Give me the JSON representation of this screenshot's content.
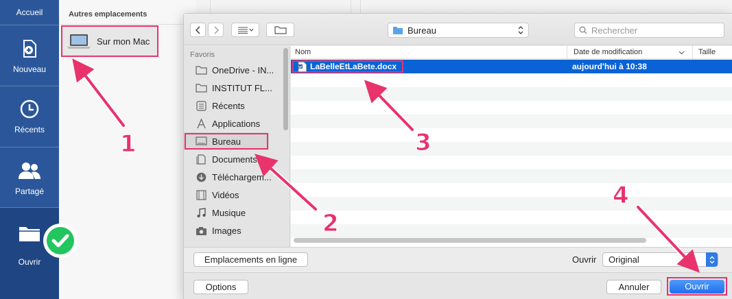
{
  "word_sidebar": {
    "home_label": "Accueil",
    "items": [
      {
        "label": "Nouveau",
        "icon": "new-document-icon"
      },
      {
        "label": "Récents",
        "icon": "clock-icon"
      },
      {
        "label": "Partagé",
        "icon": "people-icon"
      },
      {
        "label": "Ouvrir",
        "icon": "folder-icon"
      }
    ]
  },
  "backstage": {
    "section_header": "Autres emplacements",
    "location_item": "Sur mon Mac"
  },
  "dialog": {
    "location": "Bureau",
    "search_placeholder": "Rechercher",
    "sidebar": {
      "section": "Favoris",
      "items": [
        {
          "label": "OneDrive - IN...",
          "icon": "folder-icon"
        },
        {
          "label": "INSTITUT FL...",
          "icon": "folder-icon"
        },
        {
          "label": "Récents",
          "icon": "recents-icon"
        },
        {
          "label": "Applications",
          "icon": "applications-icon"
        },
        {
          "label": "Bureau",
          "icon": "desktop-icon"
        },
        {
          "label": "Documents",
          "icon": "documents-icon"
        },
        {
          "label": "Téléchargem...",
          "icon": "downloads-icon"
        },
        {
          "label": "Vidéos",
          "icon": "film-icon"
        },
        {
          "label": "Musique",
          "icon": "music-icon"
        },
        {
          "label": "Images",
          "icon": "camera-icon"
        }
      ]
    },
    "columns": {
      "name": "Nom",
      "date": "Date de modification",
      "size": "Taille"
    },
    "files": [
      {
        "name": "LaBelleEtLaBete.docx",
        "date": "aujourd'hui à 10:38",
        "icon": "word-document-icon"
      }
    ],
    "online_locations_button": "Emplacements en ligne",
    "open_mode_label": "Ouvrir",
    "open_mode_value": "Original",
    "options_button": "Options",
    "cancel_button": "Annuler",
    "open_button": "Ouvrir"
  },
  "annotations": [
    "1",
    "2",
    "3",
    "4"
  ],
  "colors": {
    "word_blue": "#2b579a",
    "highlight": "#e8336d",
    "selection": "#0a63d6",
    "success": "#22c55e"
  }
}
